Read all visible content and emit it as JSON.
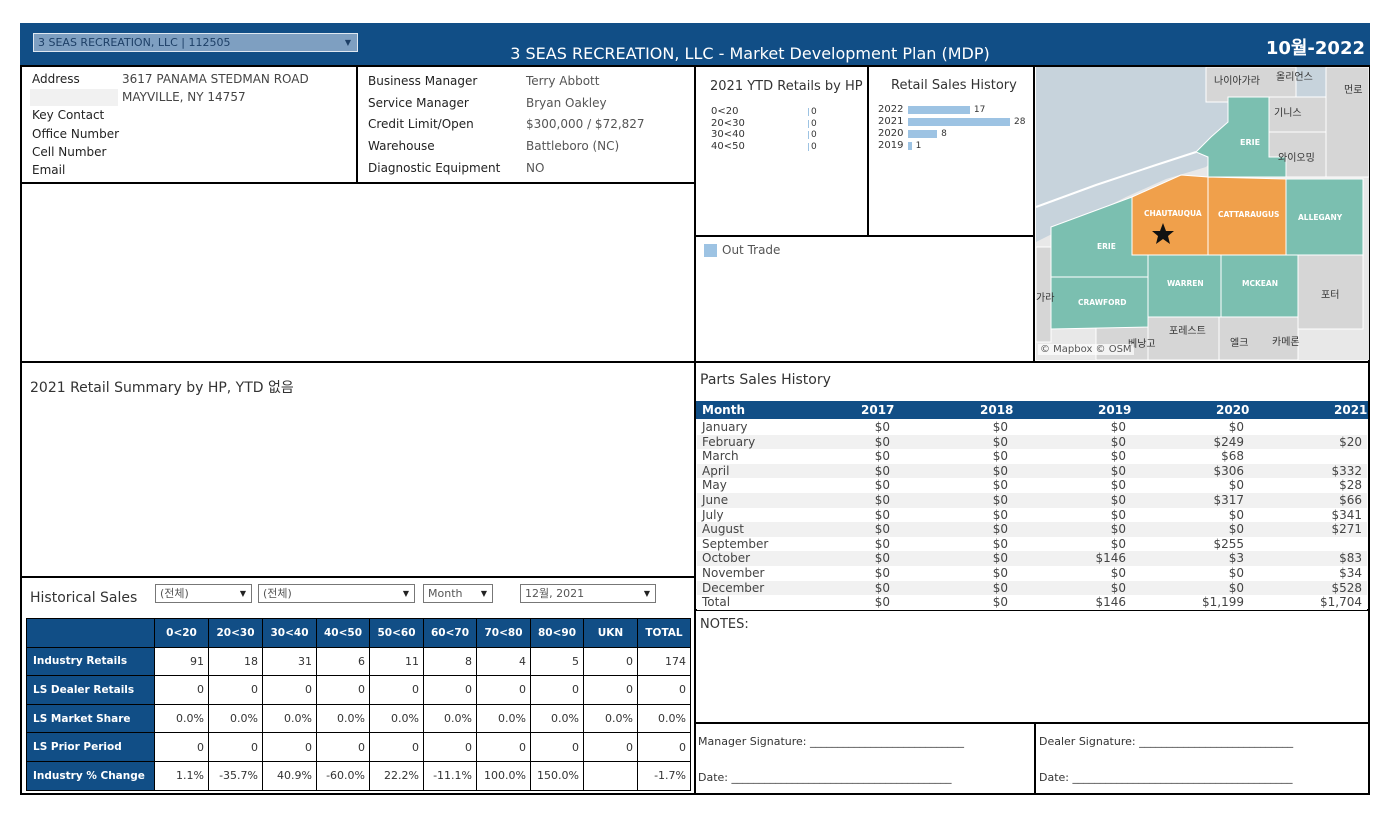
{
  "header": {
    "dealer_select": "3 SEAS RECREATION, LLC | 112505",
    "title": "3 SEAS RECREATION, LLC  -  Market Development Plan (MDP)",
    "period": "10월-2022",
    "color": "#114e86"
  },
  "dealer_info": {
    "address_label": "Address",
    "address_line1": "3617 PANAMA STEDMAN ROAD",
    "address_line2": "MAYVILLE, NY 14757",
    "key_contact_label": "Key Contact",
    "office_number_label": "Office Number",
    "cell_number_label": "Cell Number",
    "email_label": "Email"
  },
  "management": {
    "business_manager_label": "Business Manager",
    "business_manager": "Terry Abbott",
    "service_manager_label": "Service Manager",
    "service_manager": "Bryan Oakley",
    "credit_label": "Credit Limit/Open",
    "credit": "$300,000 / $72,827",
    "warehouse_label": "Warehouse",
    "warehouse": "Battleboro (NC)",
    "diagnostic_label": "Diagnostic Equipment",
    "diagnostic": "NO"
  },
  "chart_data": [
    {
      "type": "bar",
      "title": "2021 YTD Retails by HP",
      "categories": [
        "0<20",
        "20<30",
        "30<40",
        "40<50"
      ],
      "values": [
        0,
        0,
        0,
        0
      ]
    },
    {
      "type": "bar",
      "title": "Retail Sales History",
      "categories": [
        "2022",
        "2021",
        "2020",
        "2019"
      ],
      "values": [
        17,
        28,
        8,
        1
      ],
      "color": "#9dc3e3"
    }
  ],
  "legend": {
    "out_trade": "Out Trade",
    "color": "#9dc3e3"
  },
  "map": {
    "attribution": "© Mapbox  © OSM",
    "labels": {
      "niagara": "나이아가라",
      "orleans": "올리언스",
      "monroe": "먼로",
      "genesee": "기니스",
      "wyoming": "와이오밍",
      "erie_ny": "ERIE",
      "chautauqua": "CHAUTAUQUA",
      "cattaraugus": "CATTARAUGUS",
      "allegany": "ALLEGANY",
      "erie_pa": "ERIE",
      "warren": "WARREN",
      "mckean": "MCKEAN",
      "crawford": "CRAWFORD",
      "potter": "포터",
      "forest": "포레스트",
      "venango": "베낭고",
      "elk": "엘크",
      "cameron": "카메론",
      "ashtabula": "가라"
    },
    "highlight_color": "#f0a04b",
    "county_color": "#7bbfb0"
  },
  "retail_summary": {
    "title": "2021 Retail Summary by HP, YTD 없음"
  },
  "parts": {
    "title": "Parts Sales History",
    "columns": [
      "Month",
      "2017",
      "2018",
      "2019",
      "2020",
      "2021"
    ],
    "rows": [
      [
        "January",
        "$0",
        "$0",
        "$0",
        "$0",
        ""
      ],
      [
        "February",
        "$0",
        "$0",
        "$0",
        "$249",
        "$20"
      ],
      [
        "March",
        "$0",
        "$0",
        "$0",
        "$68",
        ""
      ],
      [
        "April",
        "$0",
        "$0",
        "$0",
        "$306",
        "$332"
      ],
      [
        "May",
        "$0",
        "$0",
        "$0",
        "$0",
        "$28"
      ],
      [
        "June",
        "$0",
        "$0",
        "$0",
        "$317",
        "$66"
      ],
      [
        "July",
        "$0",
        "$0",
        "$0",
        "$0",
        "$341"
      ],
      [
        "August",
        "$0",
        "$0",
        "$0",
        "$0",
        "$271"
      ],
      [
        "September",
        "$0",
        "$0",
        "$0",
        "$255",
        ""
      ],
      [
        "October",
        "$0",
        "$0",
        "$146",
        "$3",
        "$83"
      ],
      [
        "November",
        "$0",
        "$0",
        "$0",
        "$0",
        "$34"
      ],
      [
        "December",
        "$0",
        "$0",
        "$0",
        "$0",
        "$528"
      ],
      [
        "Total",
        "$0",
        "$0",
        "$146",
        "$1,199",
        "$1,704"
      ]
    ]
  },
  "historical": {
    "title": "Historical Sales",
    "filters": [
      "(전체)",
      "(전체)",
      "Month",
      "12월, 2021"
    ],
    "columns": [
      "0<20",
      "20<30",
      "30<40",
      "40<50",
      "50<60",
      "60<70",
      "70<80",
      "80<90",
      "UKN",
      "TOTAL"
    ],
    "rows": [
      {
        "label": "Industry Retails",
        "values": [
          "91",
          "18",
          "31",
          "6",
          "11",
          "8",
          "4",
          "5",
          "0",
          "174"
        ]
      },
      {
        "label": "LS Dealer Retails",
        "values": [
          "0",
          "0",
          "0",
          "0",
          "0",
          "0",
          "0",
          "0",
          "0",
          "0"
        ]
      },
      {
        "label": "LS Market Share",
        "values": [
          "0.0%",
          "0.0%",
          "0.0%",
          "0.0%",
          "0.0%",
          "0.0%",
          "0.0%",
          "0.0%",
          "0.0%",
          "0.0%"
        ]
      },
      {
        "label": "LS Prior Period",
        "values": [
          "0",
          "0",
          "0",
          "0",
          "0",
          "0",
          "0",
          "0",
          "0",
          "0"
        ]
      },
      {
        "label": "Industry % Change",
        "values": [
          "1.1%",
          "-35.7%",
          "40.9%",
          "-60.0%",
          "22.2%",
          "-11.1%",
          "100.0%",
          "150.0%",
          "",
          "-1.7%"
        ]
      }
    ]
  },
  "notes": {
    "label": "NOTES:"
  },
  "signatures": {
    "manager": "Manager Signature: ____________________________",
    "dealer": "Dealer Signature: ____________________________",
    "manager_date": "Date: ________________________________________",
    "dealer_date": "Date: ________________________________________"
  }
}
